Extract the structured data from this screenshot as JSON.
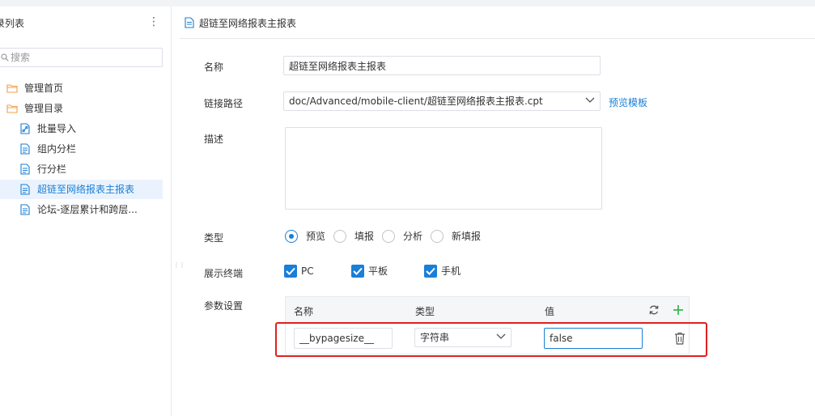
{
  "sidebar": {
    "title": "录列表",
    "search_placeholder": "搜索",
    "items": [
      {
        "label": "管理首页",
        "icon": "folder-icon"
      },
      {
        "label": "管理目录",
        "icon": "folder-icon"
      },
      {
        "label": "批量导入",
        "icon": "link-doc-icon"
      },
      {
        "label": "组内分栏",
        "icon": "doc-icon"
      },
      {
        "label": "行分栏",
        "icon": "doc-icon"
      },
      {
        "label": "超链至网络报表主报表",
        "icon": "doc-icon",
        "selected": true
      },
      {
        "label": "论坛-逐层累计和跨层...",
        "icon": "doc-icon"
      }
    ]
  },
  "header": {
    "title": "超链至网络报表主报表"
  },
  "form": {
    "name_label": "名称",
    "name_value": "超链至网络报表主报表",
    "path_label": "链接路径",
    "path_value": "doc/Advanced/mobile-client/超链至网络报表主报表.cpt",
    "preview_template_link": "预览模板",
    "desc_label": "描述",
    "desc_value": "",
    "type_label": "类型",
    "type_options": [
      "预览",
      "填报",
      "分析",
      "新填报"
    ],
    "type_selected": "预览",
    "terminal_label": "展示终端",
    "terminals": [
      {
        "label": "PC",
        "checked": true
      },
      {
        "label": "平板",
        "checked": true
      },
      {
        "label": "手机",
        "checked": true
      }
    ],
    "params_label": "参数设置",
    "params_headers": {
      "name": "名称",
      "type": "类型",
      "value": "值"
    },
    "params_rows": [
      {
        "name": "__bypagesize__",
        "type": "字符串",
        "value": "false"
      }
    ]
  },
  "colors": {
    "accent": "#1a7fd6",
    "highlight": "#e02020",
    "plus": "#3cba54",
    "folder": "#f0a04b"
  }
}
